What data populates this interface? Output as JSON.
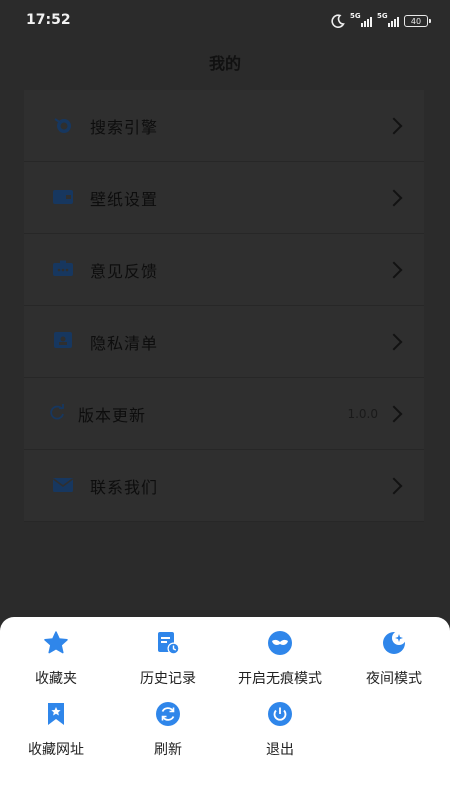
{
  "status_bar": {
    "time": "17:52",
    "signal1_label": "5G",
    "signal2_label": "5G",
    "battery": "40"
  },
  "page": {
    "title": "我的"
  },
  "menu": [
    {
      "label": "搜索引擎",
      "icon": "search-engine-icon"
    },
    {
      "label": "壁纸设置",
      "icon": "wallpaper-icon"
    },
    {
      "label": "意见反馈",
      "icon": "feedback-icon"
    },
    {
      "label": "隐私清单",
      "icon": "privacy-icon"
    },
    {
      "label": "版本更新",
      "icon": "refresh-icon",
      "value": "1.0.0"
    },
    {
      "label": "联系我们",
      "icon": "mail-icon"
    }
  ],
  "sheet": [
    {
      "label": "收藏夹",
      "icon": "star-icon"
    },
    {
      "label": "历史记录",
      "icon": "history-icon"
    },
    {
      "label": "开启无痕模式",
      "icon": "mask-icon"
    },
    {
      "label": "夜间模式",
      "icon": "moon-icon"
    },
    {
      "label": "收藏网址",
      "icon": "bookmark-icon"
    },
    {
      "label": "刷新",
      "icon": "refresh-icon"
    },
    {
      "label": "退出",
      "icon": "power-icon"
    }
  ],
  "colors": {
    "accent": "#2f86ea",
    "dim_accent": "#17375f",
    "overlay": "#2b2b2b"
  }
}
